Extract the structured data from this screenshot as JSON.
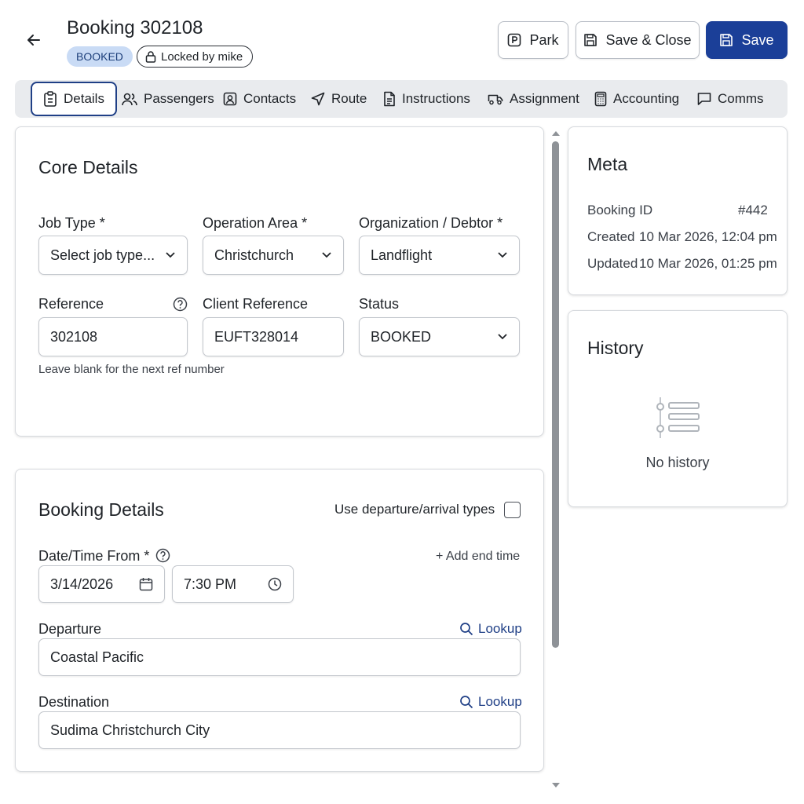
{
  "header": {
    "title": "Booking 302108",
    "status_badge": "BOOKED",
    "lock_badge": "Locked by mike",
    "park_label": "Park",
    "save_close_label": "Save & Close",
    "save_label": "Save"
  },
  "tabs": [
    {
      "label": "Details",
      "icon": "clipboard-icon",
      "active": true
    },
    {
      "label": "Passengers",
      "icon": "users-icon"
    },
    {
      "label": "Contacts",
      "icon": "contact-card-icon"
    },
    {
      "label": "Route",
      "icon": "navigation-arrow-icon"
    },
    {
      "label": "Instructions",
      "icon": "document-icon"
    },
    {
      "label": "Assignment",
      "icon": "vehicle-icon"
    },
    {
      "label": "Accounting",
      "icon": "calculator-icon"
    },
    {
      "label": "Comms",
      "icon": "chat-icon"
    }
  ],
  "core": {
    "title": "Core Details",
    "job_type_label": "Job Type *",
    "job_type_value": "Select job type...",
    "op_area_label": "Operation Area *",
    "op_area_value": "Christchurch",
    "org_label": "Organization / Debtor *",
    "org_value": "Landflight",
    "ref_label": "Reference",
    "ref_value": "302108",
    "ref_helper": "Leave blank for the next ref number",
    "client_ref_label": "Client Reference",
    "client_ref_value": "EUFT328014",
    "status_label": "Status",
    "status_value": "BOOKED"
  },
  "booking": {
    "title": "Booking Details",
    "dep_arr_label": "Use departure/arrival types",
    "datetime_label": "Date/Time From *",
    "add_end_time": "+ Add end time",
    "date_value": "3/14/2026",
    "time_value": "7:30 PM",
    "departure_label": "Departure",
    "departure_value": "Coastal Pacific",
    "destination_label": "Destination",
    "destination_value": "Sudima Christchurch City",
    "lookup_label": "Lookup"
  },
  "meta": {
    "title": "Meta",
    "booking_id_label": "Booking ID",
    "booking_id_value": "#442",
    "created_label": "Created",
    "created_value": "10 Mar 2026, 12:04 pm",
    "updated_label": "Updated",
    "updated_value": "10 Mar 2026, 01:25 pm"
  },
  "history": {
    "title": "History",
    "empty_text": "No history"
  },
  "colors": {
    "primary": "#1b3f98",
    "badge_bg": "#c9dbf5",
    "tab_bar_bg": "#e9ebee"
  }
}
